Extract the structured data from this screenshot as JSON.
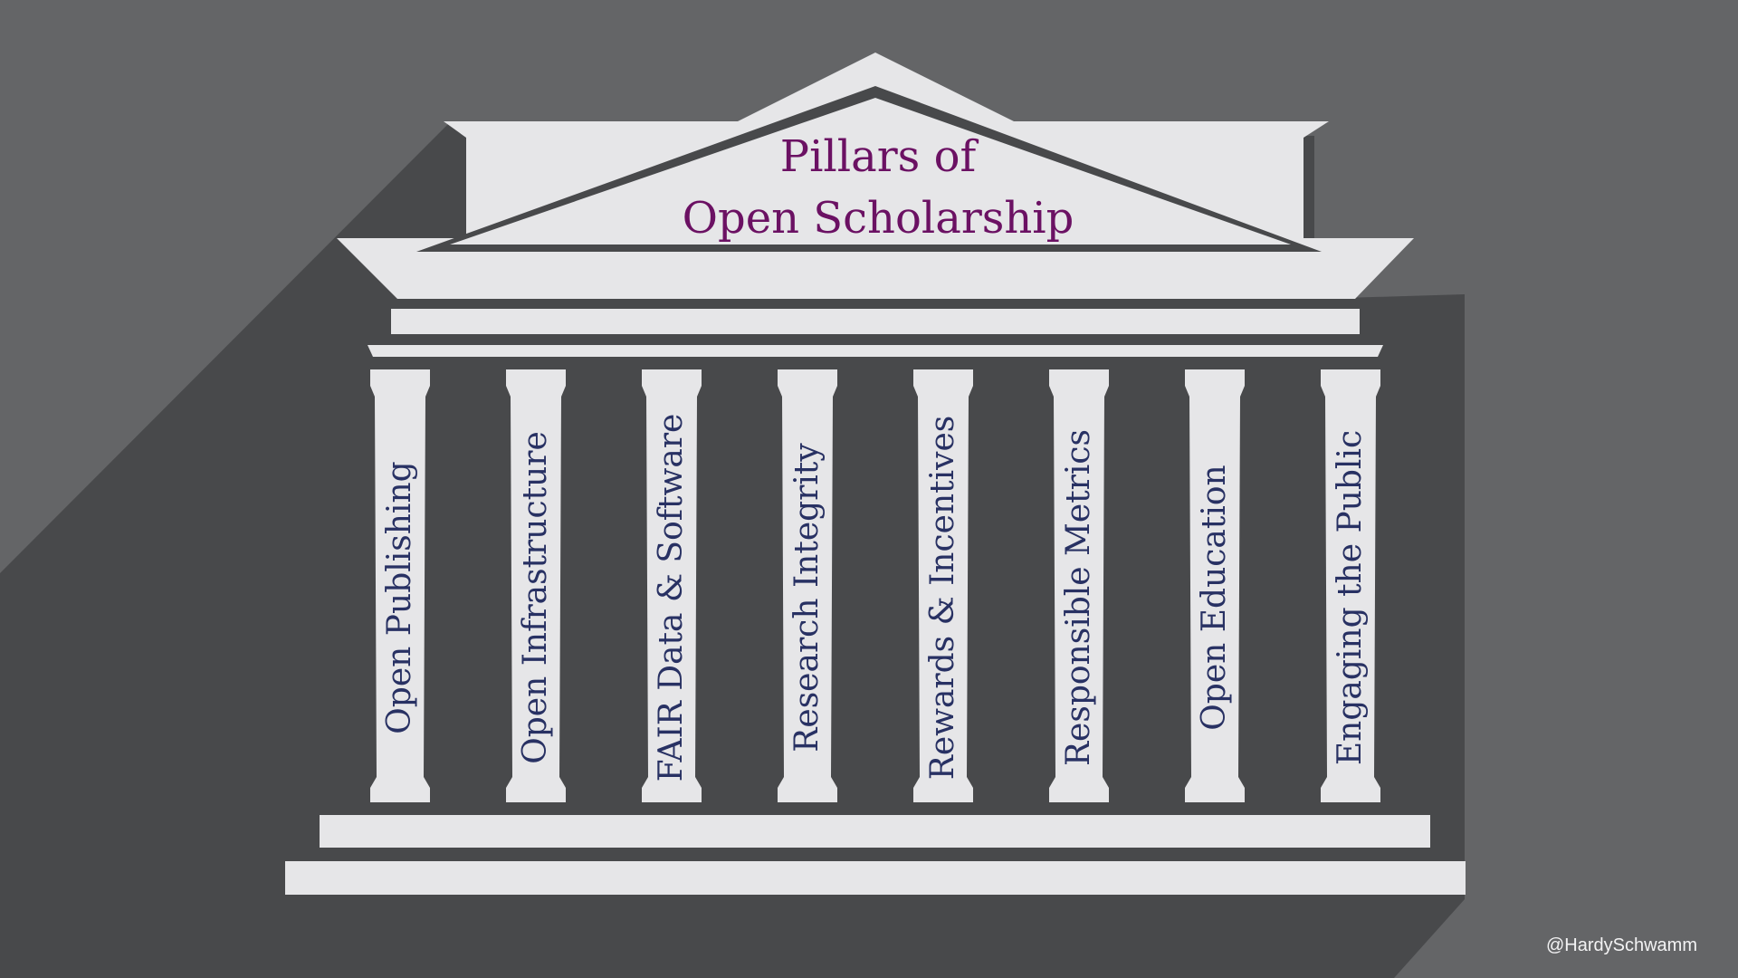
{
  "title": {
    "line1": "Pillars of",
    "line2": "Open Scholarship"
  },
  "pillars": [
    {
      "label": "Open Publishing"
    },
    {
      "label": "Open Infrastructure"
    },
    {
      "label": "FAIR Data & Software"
    },
    {
      "label": "Research Integrity"
    },
    {
      "label": "Rewards & Incentives"
    },
    {
      "label": "Responsible Metrics"
    },
    {
      "label": "Open Education"
    },
    {
      "label": "Engaging the Public"
    }
  ],
  "credit": "@HardySchwamm",
  "colors": {
    "background": "#646567",
    "shadow": "#48494b",
    "stone": "#e6e6e8",
    "title_text": "#6b1163",
    "pillar_text": "#283163",
    "credit_text": "#f3f3f4"
  }
}
